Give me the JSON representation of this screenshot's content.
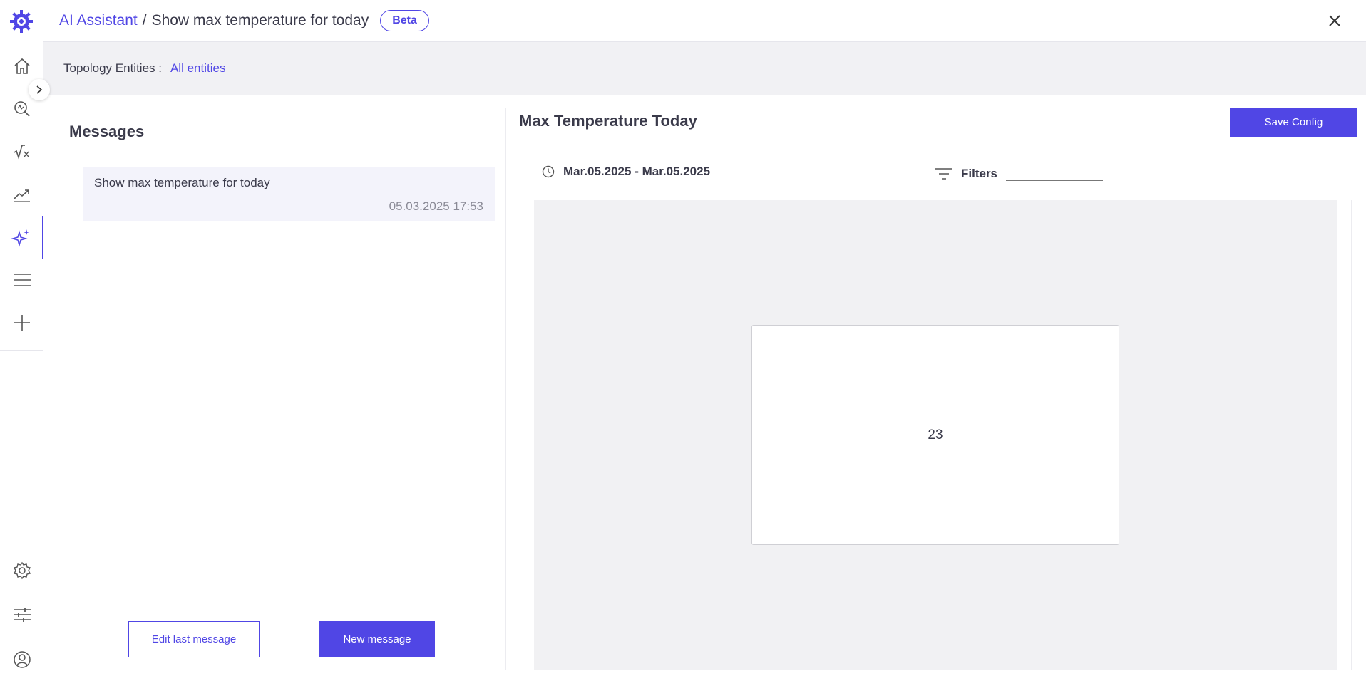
{
  "header": {
    "breadcrumb_root": "AI Assistant",
    "breadcrumb_separator": "/",
    "breadcrumb_current": "Show max temperature for today",
    "badge": "Beta"
  },
  "topology": {
    "label": "Topology Entities :",
    "value": "All entities"
  },
  "messages": {
    "title": "Messages",
    "items": [
      {
        "text": "Show max temperature for today",
        "time": "05.03.2025 17:53"
      }
    ],
    "edit_label": "Edit last message",
    "new_label": "New message"
  },
  "panel": {
    "title": "Max Temperature Today",
    "save_label": "Save Config",
    "date_range": "Mar.05.2025 - Mar.05.2025",
    "filters_label": "Filters",
    "value": "23"
  },
  "sidebar": {
    "items": [
      "home-icon",
      "search-icon",
      "formula-icon",
      "trend-icon",
      "ai-sparkle-icon",
      "menu-icon",
      "plus-icon"
    ],
    "bottom": [
      "gear-icon",
      "sliders-icon",
      "user-icon"
    ],
    "active": "ai-sparkle-icon"
  },
  "colors": {
    "accent": "#5046e5",
    "background_band": "#f1f1f4",
    "text": "#3a3a4a"
  }
}
